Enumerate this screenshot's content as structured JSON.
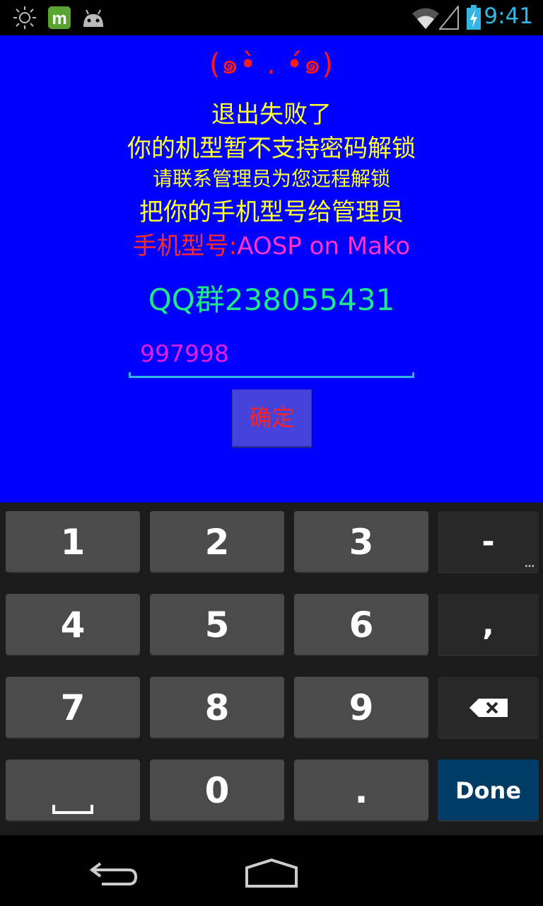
{
  "status_bar": {
    "time": "9:41",
    "icons_left": [
      "brightness-icon",
      "app-m-icon",
      "android-icon"
    ],
    "icons_right": [
      "wifi-icon",
      "signal-icon",
      "battery-charging-icon"
    ]
  },
  "app": {
    "face": "(๑•̀ . •́๑)",
    "line1": "退出失败了",
    "line2": "你的机型暂不支持密码解锁",
    "line3": "请联系管理员为您远程解锁",
    "line4": "把你的手机型号给管理员",
    "model_label": "手机型号:",
    "model_value": "AOSP on Mako",
    "qq": "QQ群238055431",
    "password_value": "997998",
    "confirm_label": "确定",
    "colors": {
      "background": "#0000ff",
      "yellow": "#ffff33",
      "red": "#ff2b2b",
      "magenta": "#ff33cc",
      "green": "#1ee88a",
      "accent": "#33b5e5"
    }
  },
  "keyboard": {
    "keys": {
      "k1": "1",
      "k2": "2",
      "k3": "3",
      "dash": "-",
      "k4": "4",
      "k5": "5",
      "k6": "6",
      "comma": ",",
      "k7": "7",
      "k8": "8",
      "k9": "9",
      "k0": "0",
      "dot": ".",
      "done": "Done"
    },
    "icons": [
      "backspace-icon",
      "space-icon",
      "more-dots-icon"
    ]
  },
  "nav_bar": {
    "icons": [
      "back-icon",
      "home-icon"
    ]
  }
}
